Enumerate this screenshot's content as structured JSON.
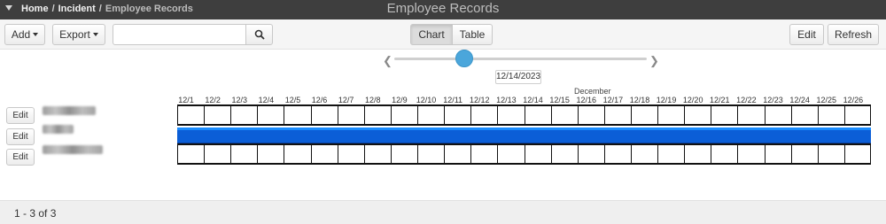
{
  "header": {
    "breadcrumb": [
      "Home",
      "Incident",
      "Employee Records"
    ],
    "title": "Employee Records"
  },
  "toolbar": {
    "add_label": "Add",
    "export_label": "Export",
    "search_value": "",
    "search_placeholder": "",
    "chart_label": "Chart",
    "table_label": "Table",
    "active_view": "Chart",
    "edit_label": "Edit",
    "refresh_label": "Refresh"
  },
  "timeline": {
    "selected_date": "12/14/2023",
    "month": "December",
    "days": [
      "12/1",
      "12/2",
      "12/3",
      "12/4",
      "12/5",
      "12/6",
      "12/7",
      "12/8",
      "12/9",
      "12/10",
      "12/11",
      "12/12",
      "12/13",
      "12/14",
      "12/15",
      "12/16",
      "12/17",
      "12/18",
      "12/19",
      "12/20",
      "12/21",
      "12/22",
      "12/23",
      "12/24",
      "12/25",
      "12/26"
    ]
  },
  "rows": [
    {
      "edit_label": "Edit",
      "name": "",
      "has_bar": false
    },
    {
      "edit_label": "Edit",
      "name": "",
      "has_bar": true
    },
    {
      "edit_label": "Edit",
      "name": "",
      "has_bar": false
    }
  ],
  "footer": {
    "count": "1 - 3 of 3"
  },
  "colors": {
    "bar": "#0b5ed7",
    "slider_handle": "#4ba6db",
    "header_bg": "#3e3e3e"
  }
}
